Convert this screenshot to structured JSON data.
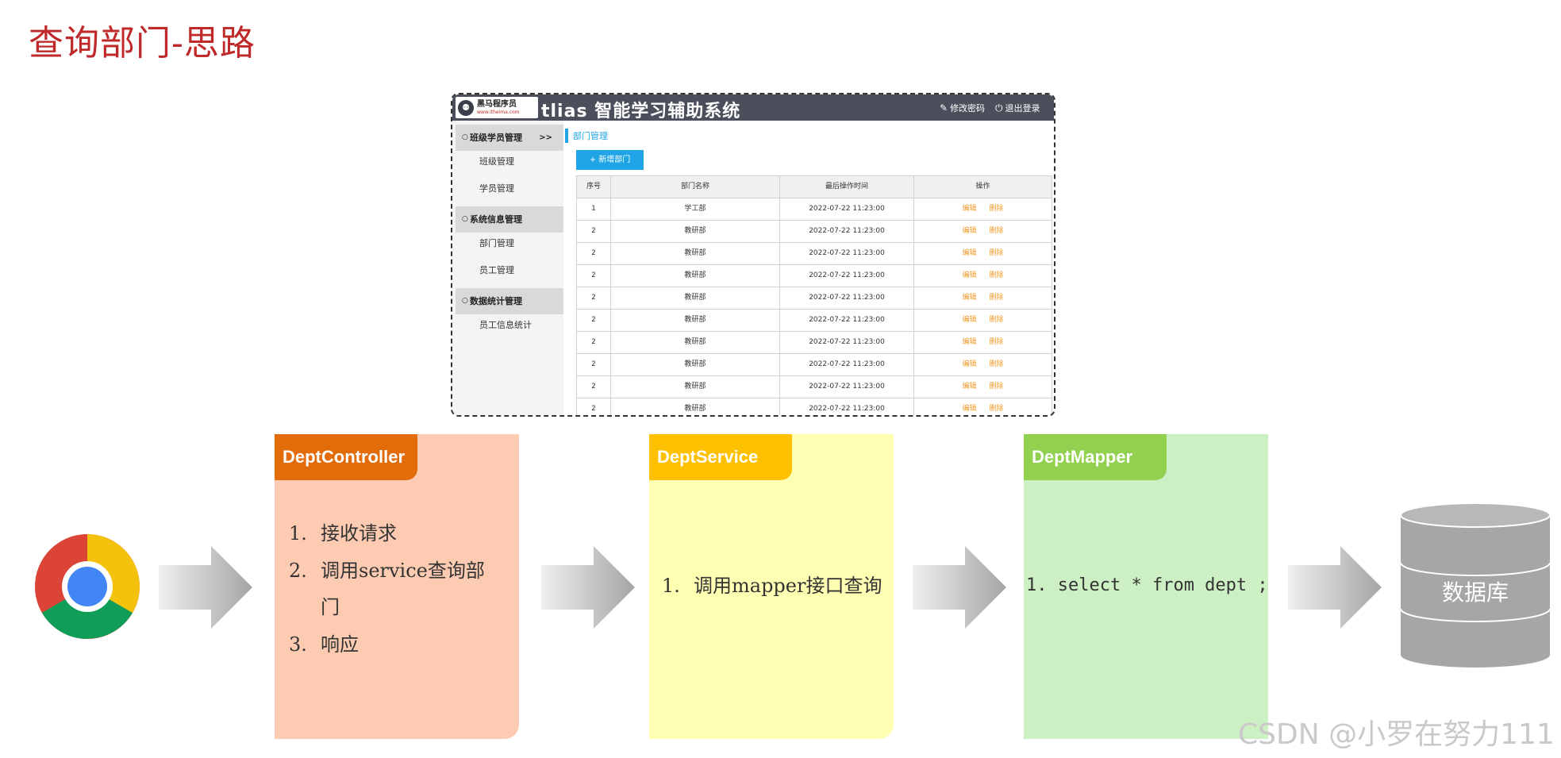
{
  "page_title": "查询部门-思路",
  "app": {
    "logo_name": "黑马程序员",
    "logo_url": "www.itheima.com",
    "title": "tlias 智能学习辅助系统",
    "change_password": "修改密码",
    "logout": "退出登录",
    "sidebar": {
      "groups": [
        {
          "label": "班级学员管理",
          "chevron": ">>"
        },
        {
          "label": "系统信息管理"
        },
        {
          "label": "数据统计管理"
        }
      ],
      "items": [
        "班级管理",
        "学员管理",
        "部门管理",
        "员工管理",
        "员工信息统计"
      ]
    },
    "breadcrumb": "部门管理",
    "add_button": "+ 新增部门",
    "table": {
      "headers": [
        "序号",
        "部门名称",
        "最后操作时间",
        "操作"
      ],
      "rows": [
        [
          "1",
          "学工部",
          "2022-07-22 11:23:00"
        ],
        [
          "2",
          "教研部",
          "2022-07-22 11:23:00"
        ],
        [
          "2",
          "教研部",
          "2022-07-22 11:23:00"
        ],
        [
          "2",
          "教研部",
          "2022-07-22 11:23:00"
        ],
        [
          "2",
          "教研部",
          "2022-07-22 11:23:00"
        ],
        [
          "2",
          "教研部",
          "2022-07-22 11:23:00"
        ],
        [
          "2",
          "教研部",
          "2022-07-22 11:23:00"
        ],
        [
          "2",
          "教研部",
          "2022-07-22 11:23:00"
        ],
        [
          "2",
          "教研部",
          "2022-07-22 11:23:00"
        ],
        [
          "2",
          "教研部",
          "2022-07-22 11:23:00"
        ]
      ],
      "edit_label": "编辑",
      "delete_label": "删除"
    }
  },
  "flow": {
    "controller": {
      "title": "DeptController",
      "steps": [
        "1.",
        "接收请求",
        "2.",
        "调用service查询部",
        "门",
        "3.",
        "响应"
      ]
    },
    "service": {
      "title": "DeptService",
      "steps": [
        "1.",
        "调用mapper接口查询"
      ]
    },
    "mapper": {
      "title": "DeptMapper",
      "steps": [
        "1.",
        "select * from dept ;"
      ]
    },
    "database_label": "数据库"
  },
  "watermark": "CSDN @小罗在努力111",
  "colors": {
    "title_red": "#c0292a",
    "controller_tab": "#e36c0a",
    "controller_body": "#fccbb1",
    "service_tab": "#ffc000",
    "service_body": "#ffffb3",
    "mapper_tab": "#92d050",
    "mapper_body": "#ccefc4",
    "accent_blue": "#1fa5e6",
    "action_orange": "#f29a2c"
  }
}
